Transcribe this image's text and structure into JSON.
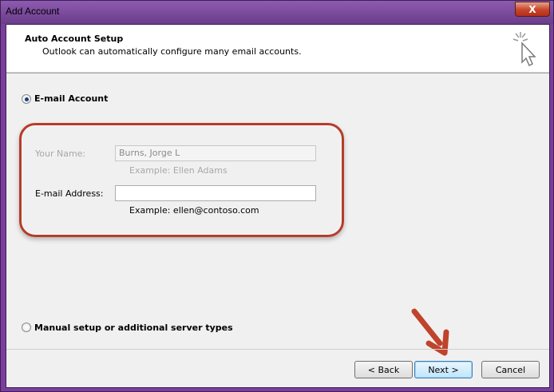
{
  "window": {
    "title": "Add Account",
    "close_label": "X"
  },
  "header": {
    "title": "Auto Account Setup",
    "subtitle": "Outlook can automatically configure many email accounts.",
    "icon": "cursor-sparkle-icon"
  },
  "options": {
    "email_account_label": "E-mail Account",
    "email_account_selected": true,
    "manual_setup_label": "Manual setup or additional server types",
    "manual_setup_selected": false
  },
  "form": {
    "name_label": "Your Name:",
    "name_value": "Burns, Jorge L",
    "name_example": "Example: Ellen Adams",
    "email_label": "E-mail Address:",
    "email_value": "",
    "email_example": "Example: ellen@contoso.com"
  },
  "buttons": {
    "back": "< Back",
    "next": "Next >",
    "cancel": "Cancel"
  },
  "colors": {
    "title_bar": "#7a3f9c",
    "highlight": "#b73c2a",
    "arrow": "#c0432b"
  }
}
